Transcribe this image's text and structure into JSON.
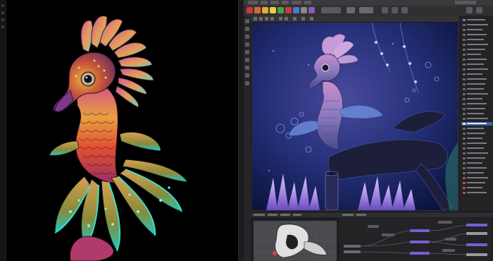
{
  "screen": {
    "left_viewport": {
      "subject": "seahorse-creature-scaled-closeup"
    },
    "right_app": {
      "render_view": {
        "subject": "seahorse-creature-underwater-scene"
      },
      "outliner": {
        "rows": 36
      },
      "node_editor": {
        "nodes": 14
      }
    }
  },
  "colors": {
    "app_background": "#2b2b2e",
    "left_background": "#000000",
    "render_background": "#141a3c",
    "node_accent": "#7b5bd6",
    "outliner_selection": "#3a62a8"
  }
}
